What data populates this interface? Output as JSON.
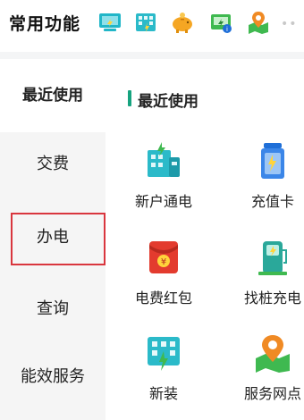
{
  "header": {
    "title": "常用功能",
    "more": "••",
    "icons": [
      "monitor-icon",
      "building-icon",
      "piggy-bank-icon",
      "wallet-icon",
      "map-location-icon"
    ]
  },
  "sidebar": {
    "items": [
      {
        "label": "最近使用",
        "active": true
      },
      {
        "label": "交费"
      },
      {
        "label": "办电",
        "highlighted": true
      },
      {
        "label": "查询"
      },
      {
        "label": "能效服务"
      }
    ]
  },
  "main": {
    "section_title": "最近使用",
    "tiles": [
      {
        "label": "新户通电",
        "icon": "building-power-icon"
      },
      {
        "label": "充值卡",
        "icon": "recharge-card-icon"
      },
      {
        "label": "电费红包",
        "icon": "red-envelope-icon"
      },
      {
        "label": "找桩充电",
        "icon": "charging-pile-icon"
      },
      {
        "label": "新装",
        "icon": "new-install-icon"
      },
      {
        "label": "服务网点",
        "icon": "service-location-icon"
      }
    ]
  },
  "colors": {
    "accent": "#16a37f",
    "highlight_border": "#d9363e",
    "nav_bg": "#f5f5f5",
    "active_bg": "#ffffff"
  }
}
